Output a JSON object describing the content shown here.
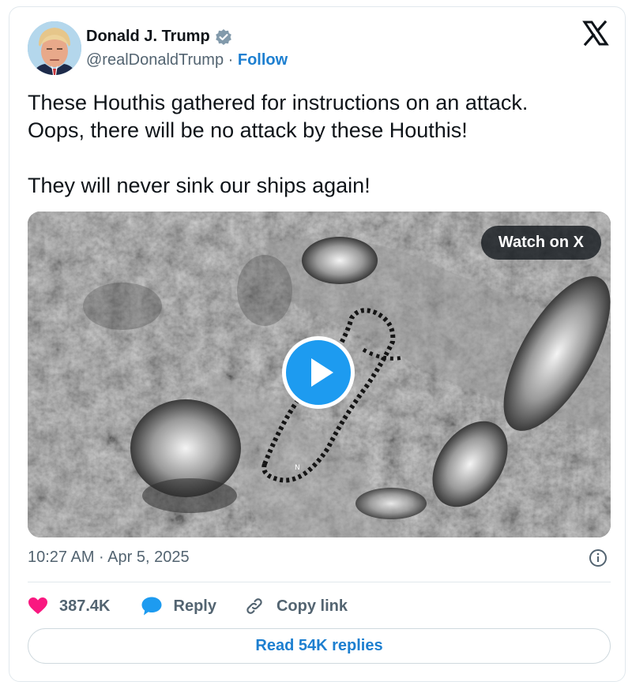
{
  "author": {
    "name": "Donald J. Trump",
    "handle": "@realDonaldTrump",
    "separator": "·",
    "follow_label": "Follow",
    "verified_color": "#829aab"
  },
  "tweet": {
    "lines": [
      "These Houthis gathered for instructions on an attack.",
      "Oops, there will be no attack by these Houthis!",
      "They will never sink our ships again!"
    ],
    "timestamp": "10:27 AM · Apr 5, 2025"
  },
  "media": {
    "watch_label": "Watch on X",
    "play_color": "#1d9bf0",
    "overlay_letter": "N"
  },
  "actions": {
    "likes": "387.4K",
    "reply_label": "Reply",
    "copy_link_label": "Copy link",
    "like_color": "#f91880",
    "reply_color": "#1d9bf0"
  },
  "read_replies_label": "Read 54K replies",
  "icons": [
    "x-logo-icon",
    "verified-badge-icon",
    "heart-icon",
    "reply-bubble-icon",
    "link-icon",
    "info-icon",
    "play-icon"
  ]
}
